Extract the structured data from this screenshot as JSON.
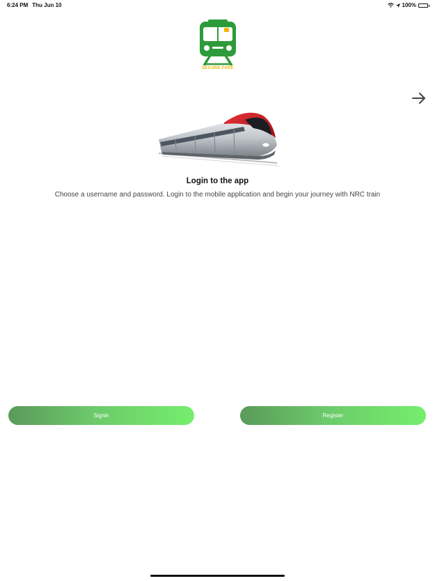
{
  "status_bar": {
    "time": "6:24 PM",
    "date": "Thu Jun 10",
    "battery": "100%"
  },
  "logo": {
    "text": "SECURE FARE",
    "icon": "train-logo-icon",
    "color": "#2e9b3a",
    "accent": "#f2b600"
  },
  "navigation": {
    "next_icon": "arrow-right-icon"
  },
  "onboarding": {
    "title": "Login to the app",
    "description": "Choose a username and password. Login to the mobile application and begin your journey with NRC train"
  },
  "buttons": {
    "signin_label": "Signin",
    "register_label": "Register"
  },
  "colors": {
    "button_gradient_start": "#5a9a5a",
    "button_gradient_end": "#74ee6c"
  }
}
